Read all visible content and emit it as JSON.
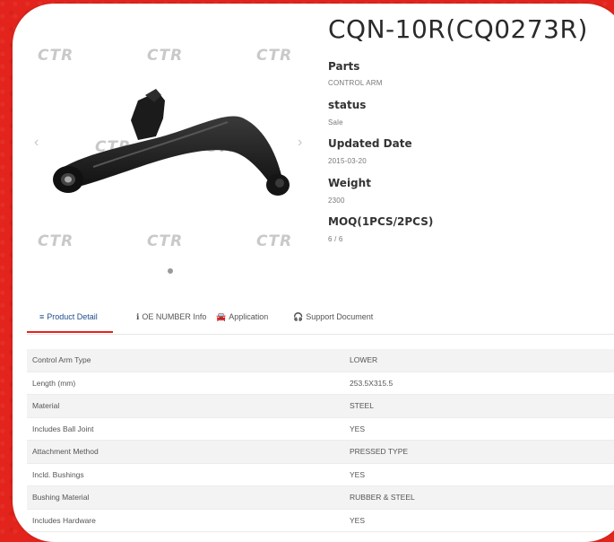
{
  "product": {
    "title": "CQN-10R(CQ0273R)"
  },
  "specs": [
    {
      "label": "Parts",
      "value": "CONTROL ARM"
    },
    {
      "label": "status",
      "value": "Sale"
    },
    {
      "label": "Updated Date",
      "value": "2015-03-20"
    },
    {
      "label": "Weight",
      "value": "2300"
    },
    {
      "label": "MOQ(1PCS/2PCS)",
      "value": "6 / 6"
    }
  ],
  "gallery": {
    "watermark": "CTR",
    "prev_glyph": "‹",
    "next_glyph": "›"
  },
  "tabs": [
    {
      "icon": "≡",
      "label": "Product Detail"
    },
    {
      "icon": "ℹ",
      "label": "OE NUMBER Info"
    },
    {
      "icon": "🚘",
      "label": "Application"
    },
    {
      "icon": "🎧",
      "label": "Support Document"
    }
  ],
  "detail_table": [
    {
      "name": "Control Arm Type",
      "value": "LOWER"
    },
    {
      "name": "Length (mm)",
      "value": "253.5X315.5"
    },
    {
      "name": "Material",
      "value": "STEEL"
    },
    {
      "name": "Includes Ball Joint",
      "value": "YES"
    },
    {
      "name": "Attachment Method",
      "value": "PRESSED TYPE"
    },
    {
      "name": "Incld. Bushings",
      "value": "YES"
    },
    {
      "name": "Bushing Material",
      "value": "RUBBER & STEEL"
    },
    {
      "name": "Includes Hardware",
      "value": "YES"
    }
  ],
  "colors": {
    "background": "#e3241c",
    "accent_underline": "#e3241c",
    "active_tab": "#1f4d8f"
  },
  "icons": {
    "product_image": "control-arm-image"
  }
}
